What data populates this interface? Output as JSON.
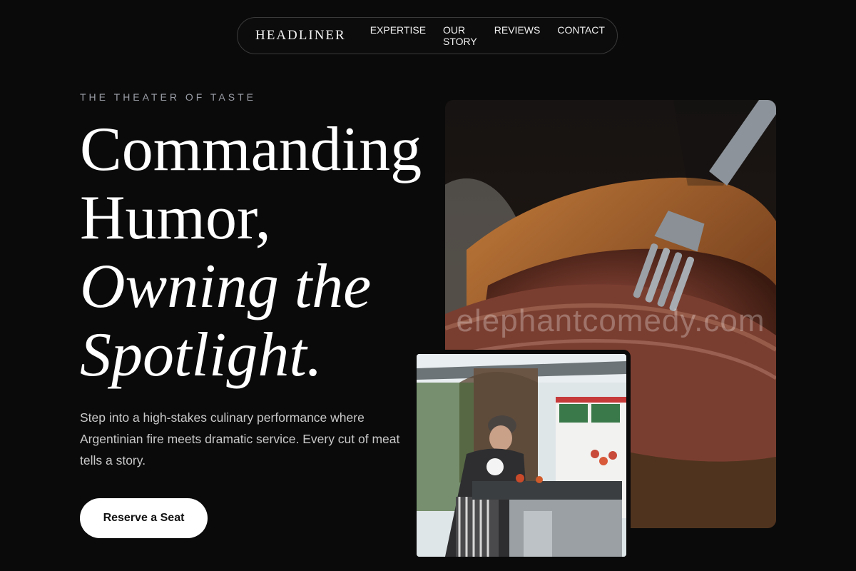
{
  "nav": {
    "brand": "HEADLINER",
    "links": [
      "EXPERTISE",
      "OUR STORY",
      "REVIEWS",
      "CONTACT"
    ]
  },
  "hero": {
    "eyebrow": "THE THEATER OF TASTE",
    "headline_line1": "Commanding",
    "headline_line2": "Humor,",
    "headline_line3": "Owning the",
    "headline_line4": "Spotlight.",
    "description": "Step into a high-stakes culinary performance where Argentinian fire meets dramatic service. Every cut of meat tells a story.",
    "cta_label": "Reserve a Seat"
  },
  "images": {
    "main_watermark": "elephantcomedy.com"
  },
  "colors": {
    "background": "#0a0a0a",
    "eyebrow": "#9a9da6",
    "cta_background": "#ffffff"
  }
}
